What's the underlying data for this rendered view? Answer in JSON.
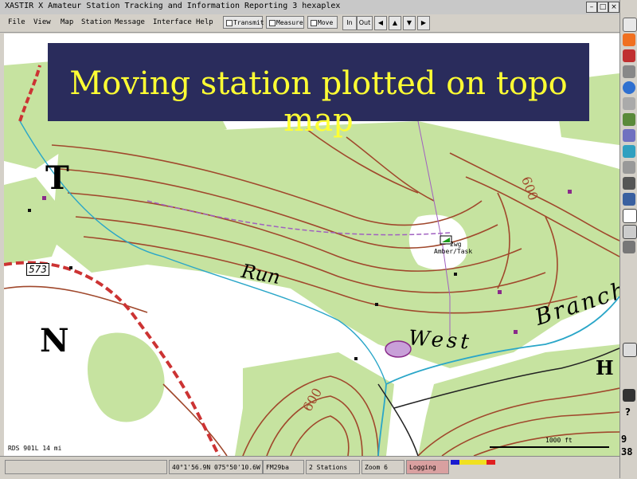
{
  "window": {
    "title": "XASTIR   X Amateur Station Tracking and Information Reporting 3 hexaplex",
    "buttons": {
      "minimize": "–",
      "maximize": "□",
      "close": "×"
    }
  },
  "menubar": {
    "items": [
      "File",
      "View",
      "Map",
      "Station",
      "Message",
      "Interface",
      "Help"
    ],
    "toggles": [
      "Transmit",
      "Measure",
      "Move"
    ],
    "zoom_in": "In",
    "zoom_out": "Out",
    "pan": {
      "left": "◀",
      "up": "▲",
      "down": "▼",
      "right": "▶"
    }
  },
  "banner": {
    "text": "Moving station plotted on topo map"
  },
  "map": {
    "place_labels": {
      "T": "T",
      "N": "N",
      "H": "H",
      "Run": "Run",
      "West": "West",
      "Branch": "Branch",
      "r573": "573",
      "e600a": "600",
      "e600b": "600"
    },
    "station": {
      "callsign_line1": "2wg",
      "callsign_line2": "Amber/Task"
    },
    "scale_label": "1000 ft",
    "bottom_left_info": "RDS 901L 14 mi",
    "colors": {
      "woods": "#c6e3a0",
      "contour": "#a0482c",
      "road": "#cc3333",
      "stream": "#2aa6c8",
      "boundary": "#a060c0",
      "banner_bg": "#2a2c5c",
      "banner_text": "#ffff33"
    }
  },
  "statusbar": {
    "coords": "40°1'56.9N  075°50'10.6W",
    "grid": "FM29ba",
    "stations": "2 Stations",
    "zoom": "Zoom 6",
    "logging": "Logging"
  },
  "tray": {
    "clock_top": "9",
    "clock_bottom": "38",
    "help": "?"
  }
}
